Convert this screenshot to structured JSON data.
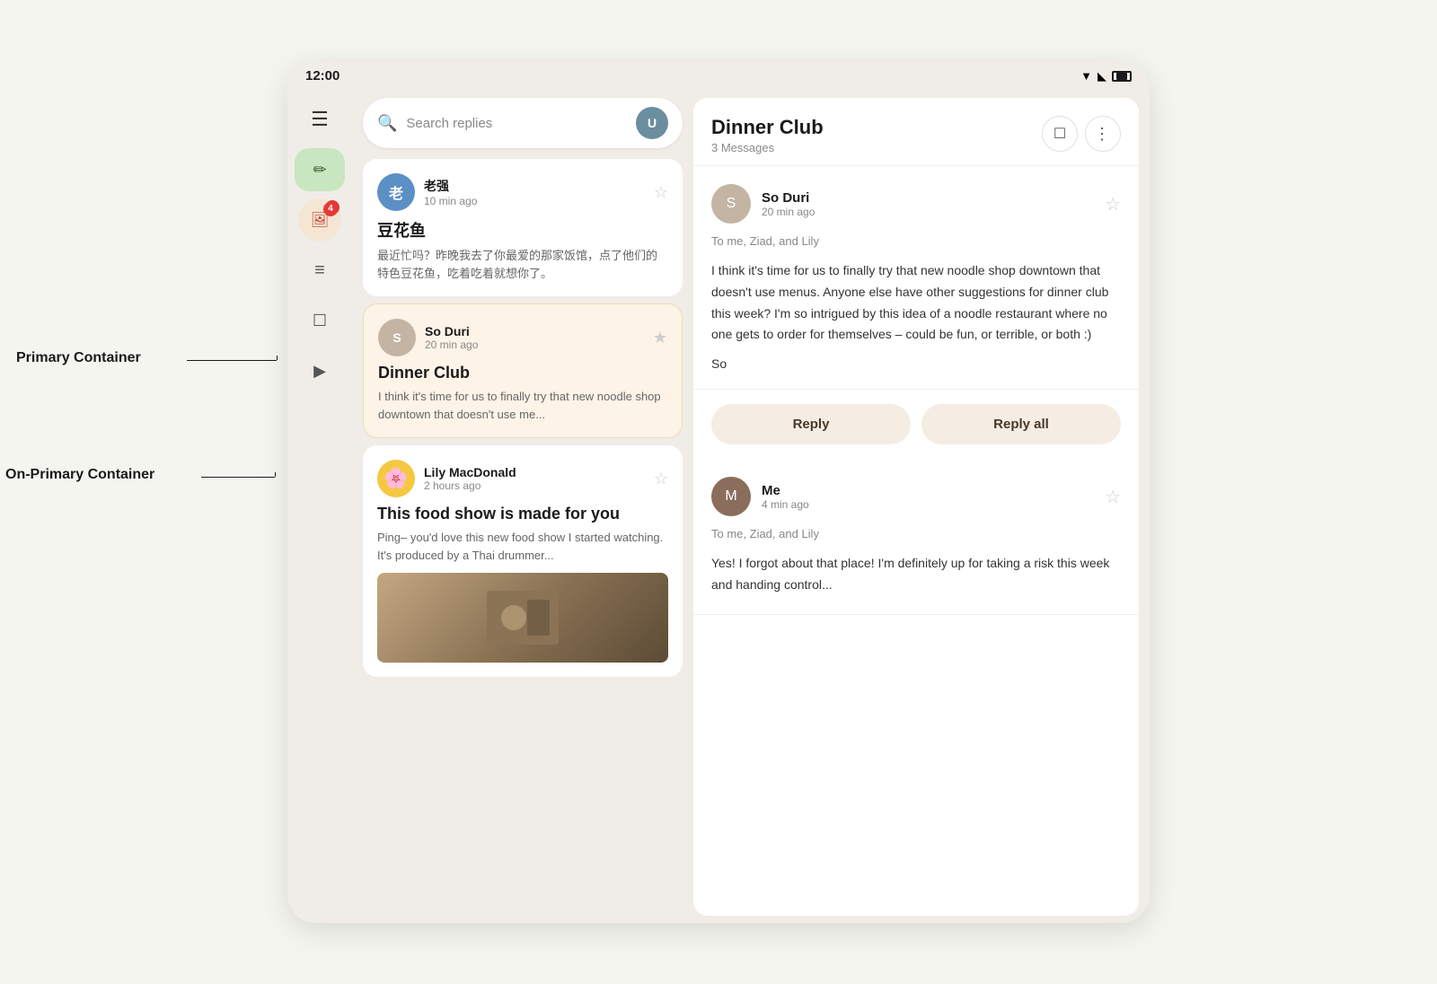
{
  "status_bar": {
    "time": "12:00",
    "icons": [
      "wifi",
      "signal",
      "battery"
    ]
  },
  "sidebar": {
    "items": [
      {
        "name": "menu",
        "icon": "☰",
        "badge": null
      },
      {
        "name": "compose",
        "icon": "✏",
        "badge": null
      },
      {
        "name": "notifications",
        "icon": "🔔",
        "badge": "4"
      },
      {
        "name": "notes",
        "icon": "≡",
        "badge": null
      },
      {
        "name": "chat",
        "icon": "☐",
        "badge": null
      },
      {
        "name": "video",
        "icon": "▷",
        "badge": null
      }
    ]
  },
  "search": {
    "placeholder": "Search replies"
  },
  "email_list": {
    "emails": [
      {
        "id": "email1",
        "sender": "老强",
        "time": "10 min ago",
        "subject": "豆花鱼",
        "preview": "最近忙吗？昨晚我去了你最爱的那家饭馆，点了他们的特色豆花鱼，吃着吃着就想你了。",
        "avatar_text": "老",
        "avatar_color": "#5c8fc4",
        "selected": false,
        "has_image": false
      },
      {
        "id": "email2",
        "sender": "So Duri",
        "time": "20 min ago",
        "subject": "Dinner Club",
        "preview": "I think it's time for us to finally try that new noodle shop downtown that doesn't use me...",
        "avatar_text": "S",
        "avatar_color": "#c4b4a4",
        "selected": true,
        "has_image": false
      },
      {
        "id": "email3",
        "sender": "Lily MacDonald",
        "time": "2 hours ago",
        "subject": "This food show is made for you",
        "preview": "Ping– you'd love this new food show I started watching. It's produced by a Thai drummer...",
        "avatar_text": "🌸",
        "avatar_color": "#f5c842",
        "selected": false,
        "has_image": true
      }
    ]
  },
  "email_detail": {
    "title": "Dinner Club",
    "subtitle": "3 Messages",
    "messages": [
      {
        "id": "msg1",
        "sender": "So Duri",
        "time": "20 min ago",
        "to": "To me, Ziad, and Lily",
        "body": "I think it's time for us to finally try that new noodle shop downtown that doesn't use menus. Anyone else have other suggestions for dinner club this week? I'm so intrigued by this idea of a noodle restaurant where no one gets to order for themselves – could be fun, or terrible, or both :)",
        "signature": "So",
        "avatar_text": "S",
        "avatar_color": "#c4b4a4",
        "starred": false
      },
      {
        "id": "msg2",
        "sender": "Me",
        "time": "4 min ago",
        "to": "To me, Ziad, and Lily",
        "body": "Yes! I forgot about that place! I'm definitely up for taking a risk this week and handing control...",
        "signature": "",
        "avatar_text": "M",
        "avatar_color": "#8b6d5c",
        "starred": false
      }
    ],
    "reply_button": "Reply",
    "reply_all_button": "Reply all"
  },
  "annotations": {
    "primary_container": "Primary Container",
    "on_primary_container": "On-Primary Container"
  }
}
